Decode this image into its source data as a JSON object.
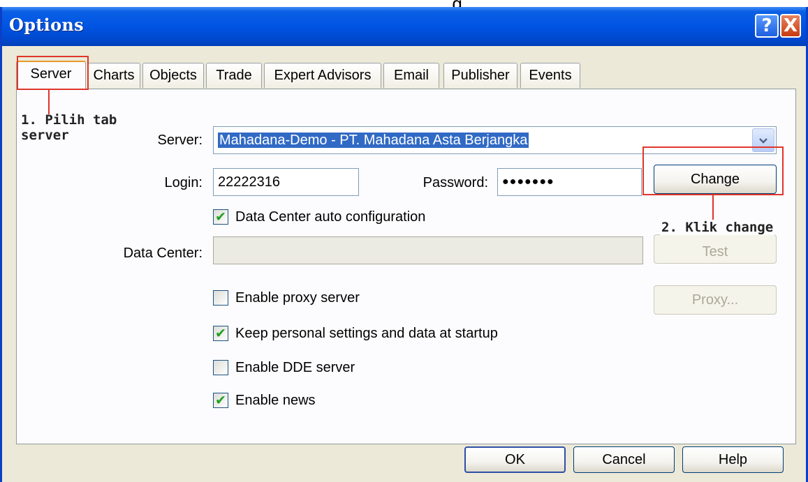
{
  "top_caption_fragment": ", … … … … g",
  "window": {
    "title": "Options",
    "help_glyph": "?",
    "close_glyph": "X"
  },
  "tabs": [
    {
      "label": "Server",
      "active": true
    },
    {
      "label": "Charts",
      "active": false
    },
    {
      "label": "Objects",
      "active": false
    },
    {
      "label": "Trade",
      "active": false
    },
    {
      "label": "Expert Advisors",
      "active": false
    },
    {
      "label": "Email",
      "active": false
    },
    {
      "label": "Publisher",
      "active": false
    },
    {
      "label": "Events",
      "active": false
    }
  ],
  "form": {
    "server_label": "Server:",
    "server_value": "Mahadana-Demo - PT. Mahadana Asta Berjangka",
    "login_label": "Login:",
    "login_value": "22222316",
    "password_label": "Password:",
    "password_value": "●●●●●●●",
    "change_button": "Change",
    "auto_config_label": "Data Center auto configuration",
    "auto_config_checked": true,
    "data_center_label": "Data Center:",
    "data_center_value": "",
    "test_button": "Test",
    "proxy_label": "Enable proxy server",
    "proxy_checked": false,
    "proxy_button": "Proxy...",
    "keep_settings_label": "Keep personal settings and data at startup",
    "keep_settings_checked": true,
    "dde_label": "Enable DDE server",
    "dde_checked": false,
    "news_label": "Enable news",
    "news_checked": true,
    "check_glyph": "✔"
  },
  "footer": {
    "ok_button": "OK",
    "cancel_button": "Cancel",
    "help_button": "Help"
  },
  "annotations": {
    "step1": "1. Pilih tab\nserver",
    "step2": "2. Klik change"
  },
  "colors": {
    "titlebar": "#0054e3",
    "selection": "#316ac5",
    "annotation": "#e0352a",
    "check": "#21a121"
  },
  "icons": {
    "help": "help-icon",
    "close": "close-icon",
    "combo": "chevron-down-icon",
    "check": "check-icon"
  }
}
